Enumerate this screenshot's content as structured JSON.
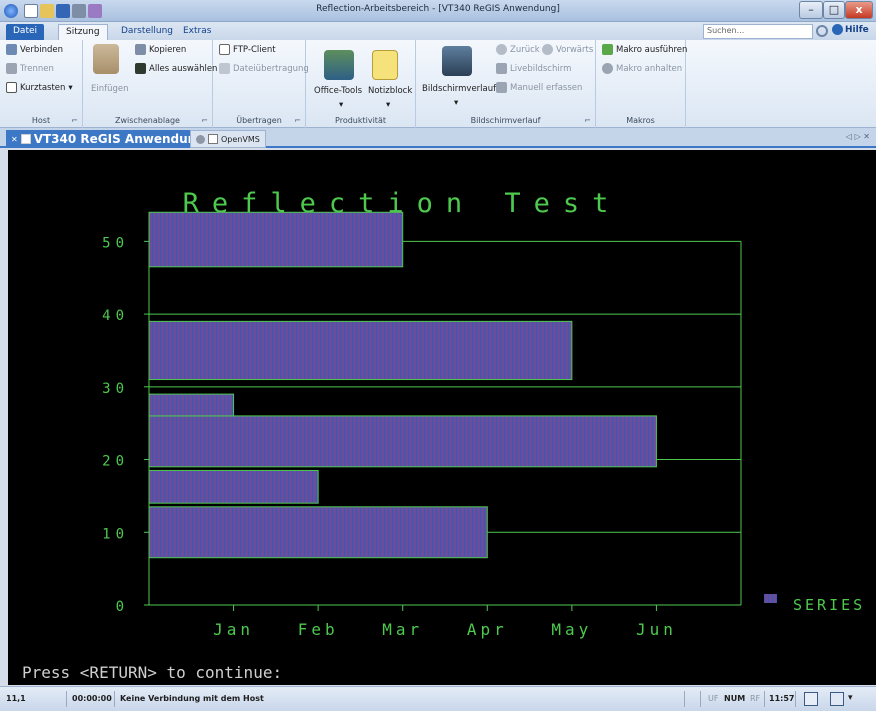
{
  "window": {
    "title": "Reflection-Arbeitsbereich - [VT340 ReGIS Anwendung]",
    "min_label": "–",
    "max_label": "□",
    "close_label": "x"
  },
  "ribbon_tabs": [
    "Datei",
    "Sitzung",
    "Darstellung",
    "Extras"
  ],
  "search": {
    "placeholder": "Suchen...",
    "help_label": "Hilfe"
  },
  "groups": {
    "host": {
      "label": "Host",
      "items": [
        "Verbinden",
        "Trennen",
        "Kurztasten"
      ]
    },
    "clipboard": {
      "label": "Zwischenablage",
      "paste": "Einfügen",
      "items": [
        "Kopieren",
        "Alles auswählen"
      ]
    },
    "transfer": {
      "label": "Übertragen",
      "items": [
        "FTP-Client",
        "Dateiübertragung"
      ]
    },
    "productivity": {
      "label": "Produktivität",
      "items": [
        "Office-Tools",
        "Notizblock"
      ]
    },
    "history": {
      "label": "Bildschirmverlauf",
      "big": "Bildschirmverlauf",
      "back": "Zurück",
      "forward": "Vorwärts",
      "live": "Livebildschirm",
      "capture": "Manuell erfassen"
    },
    "macros": {
      "label": "Makros",
      "items": [
        "Makro ausführen",
        "Makro anhalten"
      ]
    }
  },
  "doc_tabs": [
    "VT340 ReGIS Anwendung",
    "OpenVMS"
  ],
  "terminal": {
    "prompt": "Press <RETURN> to continue:",
    "colors": {
      "bg": "#000000",
      "green": "#4ec94e",
      "bar": "#6b4e9b",
      "stripe": "#3a58b8"
    }
  },
  "chart_data": {
    "type": "bar",
    "orientation": "horizontal",
    "title": "Reflection Test",
    "x_categories": [
      "Jan",
      "Feb",
      "Mar",
      "Apr",
      "May",
      "Jun"
    ],
    "y_ticks": [
      0,
      10,
      20,
      30,
      40,
      50
    ],
    "ylim": [
      0,
      55
    ],
    "xlim": [
      0,
      7
    ],
    "bars": [
      {
        "y_from": 6.5,
        "y_to": 13.5,
        "value": 4
      },
      {
        "y_from": 14,
        "y_to": 18.5,
        "value": 2
      },
      {
        "y_from": 19,
        "y_to": 26,
        "value": 6
      },
      {
        "y_from": 26,
        "y_to": 29,
        "value": 1
      },
      {
        "y_from": 31,
        "y_to": 39,
        "value": 5
      },
      {
        "y_from": 46.5,
        "y_to": 54,
        "value": 3
      }
    ],
    "series": [
      {
        "name": "SERIES"
      }
    ],
    "legend": "right",
    "grid": true
  },
  "status": {
    "position": "11,1",
    "timer": "00:00:00",
    "connection": "Keine Verbindung mit dem Host",
    "uf": "UF",
    "num": "NUM",
    "rf": "RF",
    "time": "11:57"
  }
}
